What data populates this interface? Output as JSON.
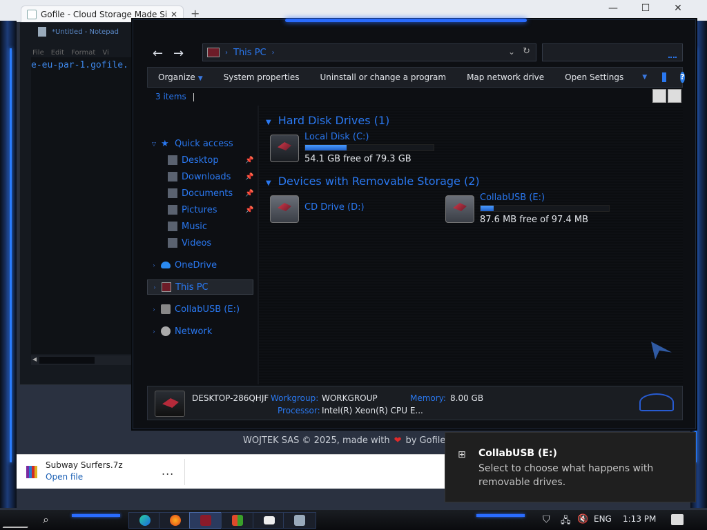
{
  "browser": {
    "tab_title": "Gofile - Cloud Storage Made Si",
    "tab_close": "✕",
    "new_tab": "+",
    "minimize": "—",
    "maximize": "☐",
    "close": "✕",
    "footer_prefix": "WOJTEK SAS © 2025, made with",
    "footer_heart": "❤",
    "footer_suffix": "by Gofile T"
  },
  "downloads": {
    "file_name": "Subway Surfers.7z",
    "open_label": "Open file",
    "more_label": "..."
  },
  "notepad": {
    "title": "*Untitled - Notepad",
    "menu": [
      "File",
      "Edit",
      "Format",
      "Vi"
    ],
    "text": "e-eu-par-1.gofile."
  },
  "explorer": {
    "address": "This PC",
    "commands": {
      "organize": "Organize",
      "system_properties": "System properties",
      "uninstall": "Uninstall or change a program",
      "map_drive": "Map network drive",
      "open_settings": "Open Settings",
      "help": "?"
    },
    "item_count": "3 items",
    "nav": {
      "quick_access": "Quick access",
      "desktop": "Desktop",
      "downloads": "Downloads",
      "documents": "Documents",
      "pictures": "Pictures",
      "music": "Music",
      "videos": "Videos",
      "onedrive": "OneDrive",
      "this_pc": "This PC",
      "collabusb": "CollabUSB (E:)",
      "network": "Network"
    },
    "groups": {
      "hdd": "Hard Disk Drives (1)",
      "removable": "Devices with Removable Storage (2)"
    },
    "drives": {
      "c": {
        "name": "Local Disk (C:)",
        "free": "54.1 GB free of 79.3 GB",
        "used_fraction": 0.32
      },
      "d": {
        "name": "CD Drive (D:)"
      },
      "e": {
        "name": "CollabUSB (E:)",
        "free": "87.6 MB free of 97.4 MB",
        "used_fraction": 0.1
      }
    },
    "details": {
      "computer_name": "DESKTOP-286QHJF",
      "workgroup_label": "Workgroup:",
      "workgroup_value": "WORKGROUP",
      "memory_label": "Memory:",
      "memory_value": "8.00 GB",
      "processor_label": "Processor:",
      "processor_value": "Intel(R) Xeon(R) CPU E..."
    }
  },
  "toast": {
    "title": "CollabUSB (E:)",
    "body": "Select to choose what happens with removable drives."
  },
  "taskbar": {
    "language": "ENG",
    "time": "1:13 PM"
  },
  "colors": {
    "accent": "#2a78f0",
    "frame_glow": "#2a6cff",
    "drive_fill": "#1e5fc8"
  }
}
